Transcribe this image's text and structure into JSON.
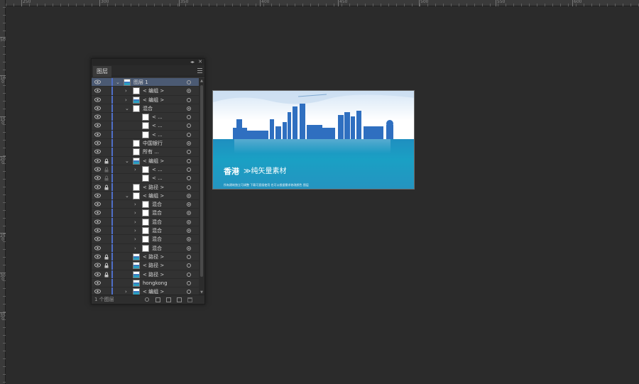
{
  "ruler": {
    "top_labels": [
      "250",
      "300",
      "350",
      "400",
      "450",
      "500",
      "550",
      "600"
    ],
    "left_labels": [
      "50",
      "100",
      "150",
      "200",
      "250",
      "300",
      "350"
    ]
  },
  "panel": {
    "tab_label": "图层",
    "footer_count": "1 个图层",
    "layers": [
      {
        "name": "图层 1",
        "chevron": "v",
        "thumb": "art",
        "target": "open"
      },
      {
        "name": "< 编组 >",
        "chevron": ">",
        "thumb": "white",
        "target": "filled"
      },
      {
        "name": "< 编组 >",
        "chevron": ">",
        "thumb": "art",
        "target": "open"
      },
      {
        "name": "混合",
        "chevron": "v",
        "thumb": "white",
        "target": "filled"
      },
      {
        "name": "< ...",
        "chevron": "",
        "thumb": "white",
        "target": "open"
      },
      {
        "name": "< ...",
        "chevron": "",
        "thumb": "white",
        "target": "open"
      },
      {
        "name": "< ...",
        "chevron": "",
        "thumb": "white",
        "target": "open"
      },
      {
        "name": "中国银行",
        "chevron": "",
        "thumb": "white",
        "target": "filled"
      },
      {
        "name": "所有 ...",
        "chevron": "",
        "thumb": "white",
        "target": "open"
      },
      {
        "name": "< 编组 >",
        "chevron": "v",
        "thumb": "art",
        "target": "open"
      },
      {
        "name": "< ...",
        "chevron": ">",
        "thumb": "white",
        "target": "open"
      },
      {
        "name": "< ...",
        "chevron": "",
        "thumb": "white",
        "target": "open"
      },
      {
        "name": "< 路径 >",
        "chevron": "",
        "thumb": "white",
        "target": "open"
      },
      {
        "name": "< 编组 >",
        "chevron": "v",
        "thumb": "white",
        "target": "filled"
      },
      {
        "name": "混合",
        "chevron": ">",
        "thumb": "white",
        "target": "filled"
      },
      {
        "name": "混合",
        "chevron": ">",
        "thumb": "white",
        "target": "filled"
      },
      {
        "name": "混合",
        "chevron": ">",
        "thumb": "white",
        "target": "filled"
      },
      {
        "name": "混合",
        "chevron": ">",
        "thumb": "white",
        "target": "filled"
      },
      {
        "name": "混合",
        "chevron": ">",
        "thumb": "white",
        "target": "filled"
      },
      {
        "name": "混合",
        "chevron": ">",
        "thumb": "white",
        "target": "filled"
      },
      {
        "name": "< 路径 >",
        "chevron": "",
        "thumb": "art",
        "target": "open"
      },
      {
        "name": "< 路径 >",
        "chevron": "",
        "thumb": "art",
        "target": "open"
      },
      {
        "name": "< 路径 >",
        "chevron": "",
        "thumb": "art",
        "target": "open"
      },
      {
        "name": "hongkong",
        "chevron": "",
        "thumb": "art",
        "target": "open"
      },
      {
        "name": "< 编组 >",
        "chevron": ">",
        "thumb": "art",
        "target": "open"
      }
    ]
  },
  "artboard": {
    "title": "香港",
    "subtitle": "≫纯矢量素材",
    "caption": "所有建筑独立可调整 下载可直接使用 也可以根据需求修改颜色 图层"
  },
  "colors": {
    "canvas_bg": "#2b2b2b",
    "layer_color": "#4f6fc8",
    "selected_row": "#4b5a73",
    "sea": "#1f8fc0",
    "building": "#2f6fc0"
  }
}
